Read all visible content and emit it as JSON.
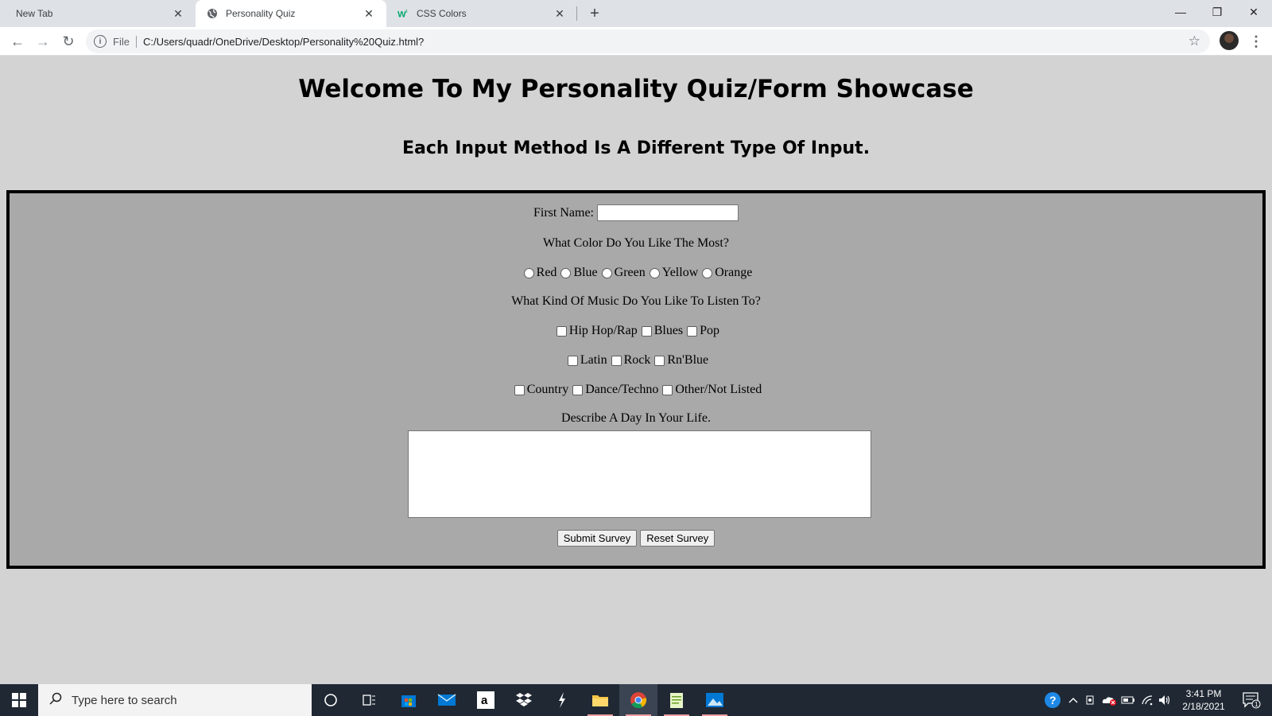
{
  "browser": {
    "tabs": [
      {
        "title": "New Tab",
        "close": "✕"
      },
      {
        "title": "Personality Quiz",
        "close": "✕"
      },
      {
        "title": "CSS Colors",
        "close": "✕"
      }
    ],
    "new_tab": "+",
    "window_controls": {
      "minimize": "—",
      "restore": "❐",
      "close": "✕"
    },
    "nav": {
      "back": "←",
      "forward": "→",
      "reload": "↻"
    },
    "address_bar": {
      "info_icon": "i",
      "scheme_label": "File",
      "url": "C:/Users/quadr/OneDrive/Desktop/Personality%20Quiz.html?",
      "star": "☆"
    },
    "menu": "⋮"
  },
  "page": {
    "title": "Welcome To My Personality Quiz/Form Showcase",
    "subtitle": "Each Input Method Is A Different Type Of Input.",
    "form": {
      "first_name_label": "First Name:",
      "first_name_value": "",
      "color_question": "What Color Do You Like The Most?",
      "color_options": [
        "Red",
        "Blue",
        "Green",
        "Yellow",
        "Orange"
      ],
      "music_question": "What Kind Of Music Do You Like To Listen To?",
      "music_options_row1": [
        "Hip Hop/Rap",
        "Blues",
        "Pop"
      ],
      "music_options_row2": [
        "Latin",
        "Rock",
        "Rn'Blue"
      ],
      "music_options_row3": [
        "Country",
        "Dance/Techno",
        "Other/Not Listed"
      ],
      "describe_label": "Describe A Day In Your Life.",
      "describe_value": "",
      "submit_label": "Submit Survey",
      "reset_label": "Reset Survey"
    }
  },
  "taskbar": {
    "search_placeholder": "Type here to search",
    "time": "3:41 PM",
    "date": "2/18/2021",
    "notification_count": "1"
  }
}
